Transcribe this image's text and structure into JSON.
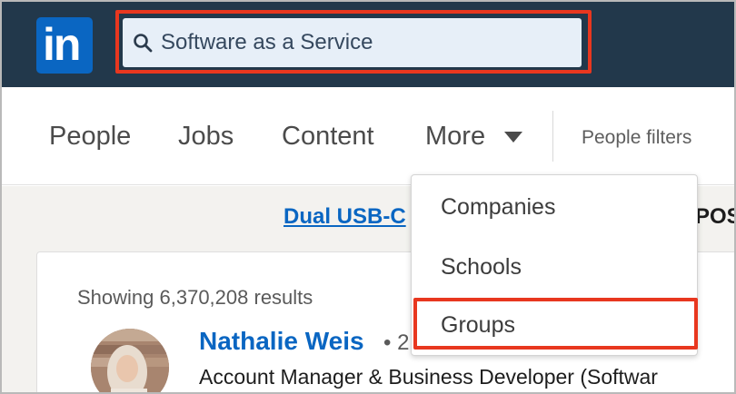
{
  "colors": {
    "topbar_bg": "#22384b",
    "brand_blue": "#0a66c2",
    "highlight_red": "#e8371f",
    "search_bg": "#e7eff8"
  },
  "logo": {
    "text": "in",
    "icon": "linkedin-logo"
  },
  "search": {
    "query": "Software as a Service",
    "icon": "search-icon"
  },
  "tabs": [
    {
      "label": "People"
    },
    {
      "label": "Jobs"
    },
    {
      "label": "Content"
    },
    {
      "label": "More",
      "icon": "caret-down-icon"
    }
  ],
  "people_filters_label": "People filters",
  "dropdown": {
    "items": [
      {
        "label": "Companies"
      },
      {
        "label": "Schools"
      },
      {
        "label": "Groups",
        "highlighted": true
      }
    ]
  },
  "ad": {
    "link_text": "Dual USB-C",
    "right_text": "POS"
  },
  "results": {
    "count_text": "Showing 6,370,208 results",
    "first": {
      "name": "Nathalie Weis",
      "degree": "• 2",
      "headline": "Account Manager & Business Developer (Softwar"
    }
  }
}
